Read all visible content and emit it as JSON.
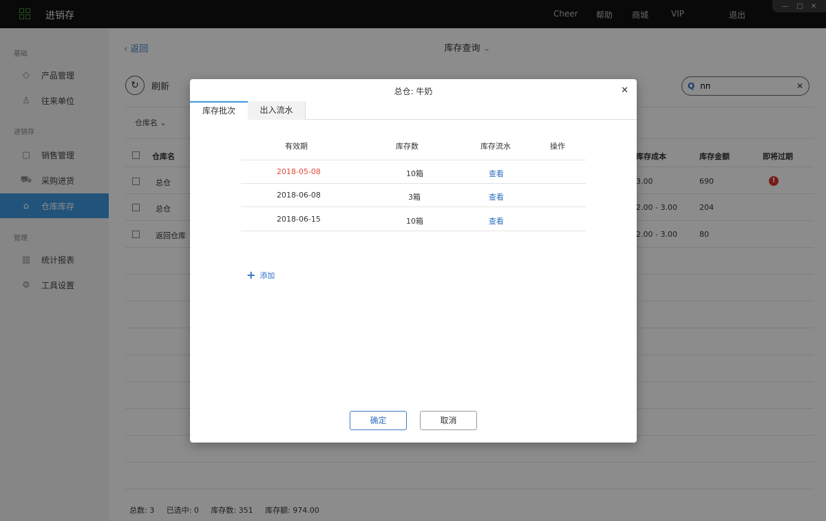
{
  "window": {
    "app_title": "进销存",
    "nav": [
      "Cheer",
      "帮助",
      "商城",
      "VIP",
      "退出"
    ],
    "controls": [
      "—",
      "□",
      "✕"
    ]
  },
  "sidebar": {
    "groups": [
      {
        "label": "基础",
        "items": [
          {
            "label": "产品管理",
            "icon": "tag-icon"
          },
          {
            "label": "往来单位",
            "icon": "contacts-icon"
          }
        ]
      },
      {
        "label": "进销存",
        "items": [
          {
            "label": "销售管理",
            "icon": "clipboard-icon"
          },
          {
            "label": "采购进货",
            "icon": "cart-icon"
          },
          {
            "label": "仓库库存",
            "icon": "warehouse-icon",
            "active": true
          }
        ]
      },
      {
        "label": "管理",
        "items": [
          {
            "label": "统计报表",
            "icon": "chart-icon"
          },
          {
            "label": "工具设置",
            "icon": "gear-icon"
          }
        ]
      }
    ]
  },
  "main": {
    "back_label": "返回",
    "page_title": "库存查询",
    "refresh_label": "刷新",
    "search_value": "nn",
    "filter_label": "仓库名",
    "columns": {
      "name": "仓库名",
      "cost": "库存成本",
      "amount": "库存金额",
      "expiring": "即将过期"
    },
    "rows": [
      {
        "name": "总仓",
        "cost": "3.00",
        "amount": "690",
        "expiring": true
      },
      {
        "name": "总仓",
        "cost": "2.00 - 3.00",
        "amount": "204",
        "expiring": false
      },
      {
        "name": "返回仓库",
        "cost": "2.00 - 3.00",
        "amount": "80",
        "expiring": false
      }
    ],
    "footer": {
      "total": "总数:  3",
      "selected": "已选中:  0",
      "stock_count": "库存数:  351",
      "stock_amount": "库存额:  974.00"
    }
  },
  "dialog": {
    "title": "总仓: 牛奶",
    "tabs": [
      "库存批次",
      "出入流水"
    ],
    "columns": [
      "有效期",
      "库存数",
      "库存流水",
      "操作"
    ],
    "rows": [
      {
        "expiry": "2018-05-08",
        "qty": "10箱",
        "link": "查看",
        "expired": true
      },
      {
        "expiry": "2018-06-08",
        "qty": "3箱",
        "link": "查看",
        "expired": false
      },
      {
        "expiry": "2018-06-15",
        "qty": "10箱",
        "link": "查看",
        "expired": false
      }
    ],
    "add_label": "添加",
    "confirm_label": "确定",
    "cancel_label": "取消"
  }
}
